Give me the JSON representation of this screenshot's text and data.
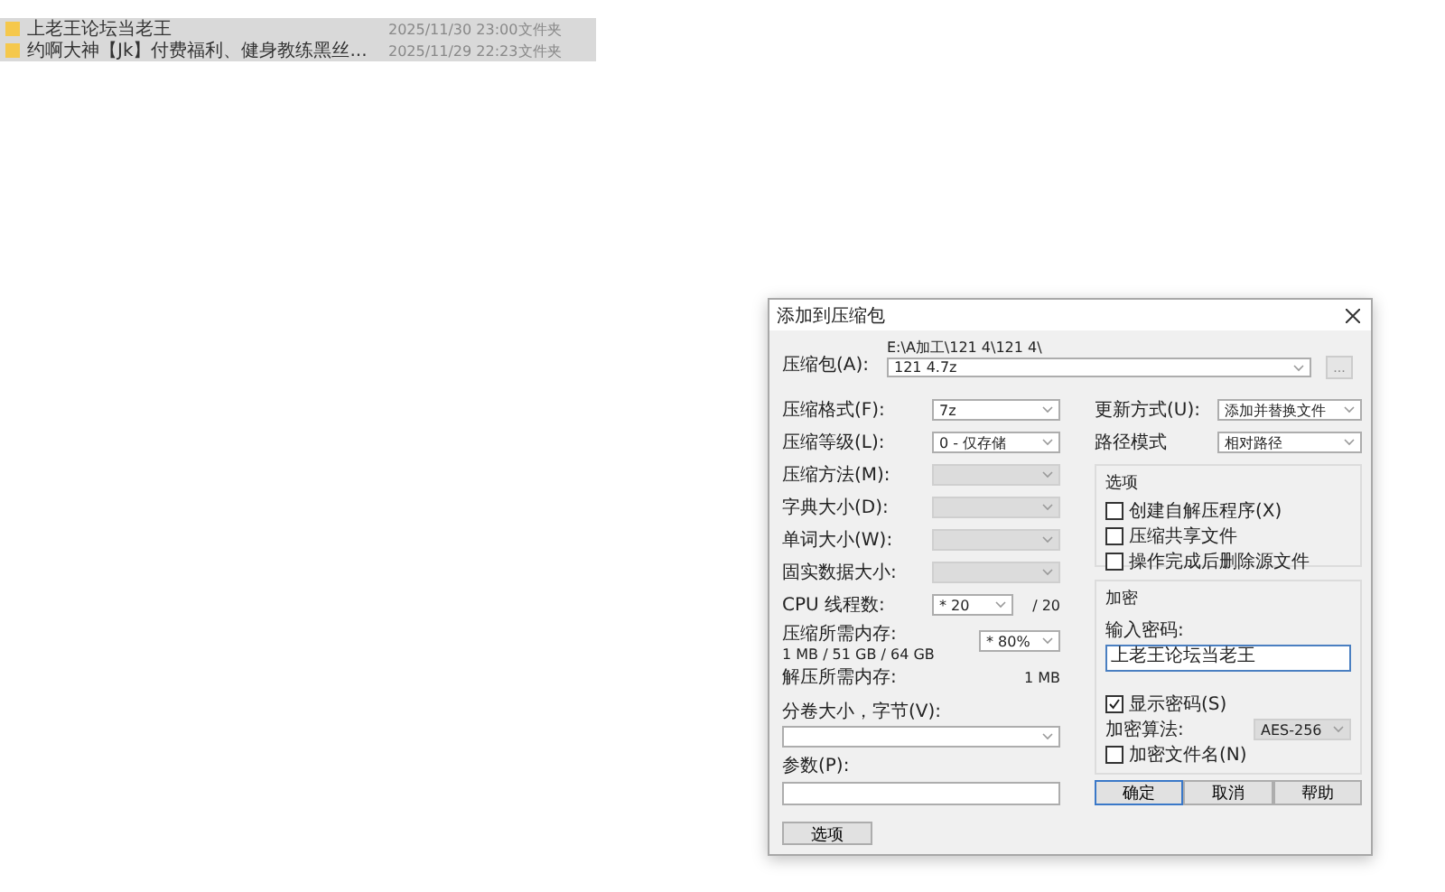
{
  "file_list": {
    "rows": [
      {
        "name": "上老王论坛当老王",
        "modified": "2025/11/30 23:00",
        "type": "文件夹",
        "selected": true
      },
      {
        "name": "约啊大神【Jk】付费福利、健身教练黑丝...",
        "modified": "2025/11/29 22:23",
        "type": "文件夹",
        "selected": true
      }
    ]
  },
  "dialog": {
    "title": "添加到压缩包",
    "archive": {
      "label": "压缩包(A):",
      "path": "E:\\A加工\\121 4\\121 4\\",
      "value": "121 4.7z",
      "browse": "..."
    },
    "left_fields": [
      {
        "kind": "combo",
        "label": "压缩格式(F):",
        "value": "7z",
        "disabled": false
      },
      {
        "kind": "combo",
        "label": "压缩等级(L):",
        "value": "0 - 仅存储",
        "disabled": false
      },
      {
        "kind": "combo",
        "label": "压缩方法(M):",
        "disabled": true
      },
      {
        "kind": "combo",
        "label": "字典大小(D):",
        "disabled": true
      },
      {
        "kind": "combo",
        "label": "单词大小(W):",
        "disabled": true
      },
      {
        "kind": "combo",
        "label": "固实数据大小:",
        "disabled": true
      },
      {
        "kind": "threads",
        "label": "CPU 线程数:",
        "value": "* 20",
        "suffix": "/ 20"
      },
      {
        "kind": "memory",
        "label": "压缩所需内存:",
        "detail": "1 MB / 51 GB / 64 GB",
        "value": "* 80%"
      },
      {
        "kind": "info",
        "label": "解压所需内存:",
        "value": "1 MB"
      },
      {
        "kind": "wide_combo",
        "label": "分卷大小，字节(V):"
      },
      {
        "kind": "wide_text",
        "label": "参数(P):"
      }
    ],
    "options_button": "选项",
    "right_fields": [
      {
        "label": "更新方式(U):",
        "value": "添加并替换文件"
      },
      {
        "label": "路径模式",
        "value": "相对路径"
      }
    ],
    "options_group": {
      "title": "选项",
      "checkboxes": [
        {
          "label": "创建自解压程序(X)",
          "checked": false
        },
        {
          "label": "压缩共享文件",
          "checked": false
        },
        {
          "label": "操作完成后删除源文件",
          "checked": false
        }
      ]
    },
    "encryption": {
      "title": "加密",
      "password_label": "输入密码:",
      "password_value": "上老王论坛当老王",
      "show_password": {
        "label": "显示密码(S)",
        "checked": true
      },
      "algorithm": {
        "label": "加密算法:",
        "value": "AES-256"
      },
      "encrypt_names": {
        "label": "加密文件名(N)",
        "checked": false
      }
    },
    "buttons": [
      {
        "label": "确定",
        "default": true
      },
      {
        "label": "取消",
        "default": false
      },
      {
        "label": "帮助",
        "default": false
      }
    ]
  }
}
